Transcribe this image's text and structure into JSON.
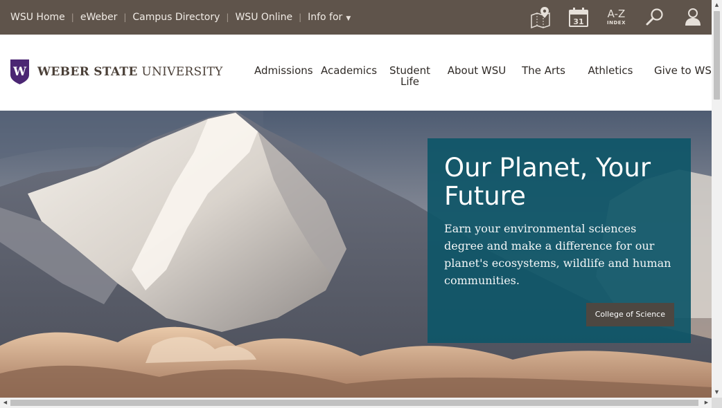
{
  "utility_bar": {
    "links": [
      "WSU Home",
      "eWeber",
      "Campus Directory",
      "WSU Online"
    ],
    "info_for_label": "Info for",
    "info_caret": "▼",
    "separator": "|",
    "icons": {
      "map": "map-pin-icon",
      "calendar": "calendar-icon",
      "calendar_day": "31",
      "az_big": "A-Z",
      "az_small": "INDEX",
      "search": "search-icon",
      "user": "user-icon"
    },
    "colors": {
      "background": "#5f544b",
      "text": "#f1ece6"
    }
  },
  "header": {
    "logo_text_bold": "WEBER STATE",
    "logo_text_regular": "UNIVERSITY",
    "logo_letter": "W",
    "nav": [
      "Admissions",
      "Academics",
      "Student Life",
      "About WSU",
      "The Arts",
      "Athletics",
      "Give to WSU"
    ],
    "colors": {
      "brand_purple": "#4b2673"
    }
  },
  "hero": {
    "title": "Our Planet, Your Future",
    "description": "Earn your environmental sciences degree and make a difference for our planet's ecosystems, wildlife and human communities.",
    "button_label": "College of Science",
    "colors": {
      "panel": "#0e5668",
      "button": "#4d4741"
    }
  },
  "scrollbars": {
    "up": "▲",
    "down": "▼",
    "left": "◀",
    "right": "▶"
  }
}
